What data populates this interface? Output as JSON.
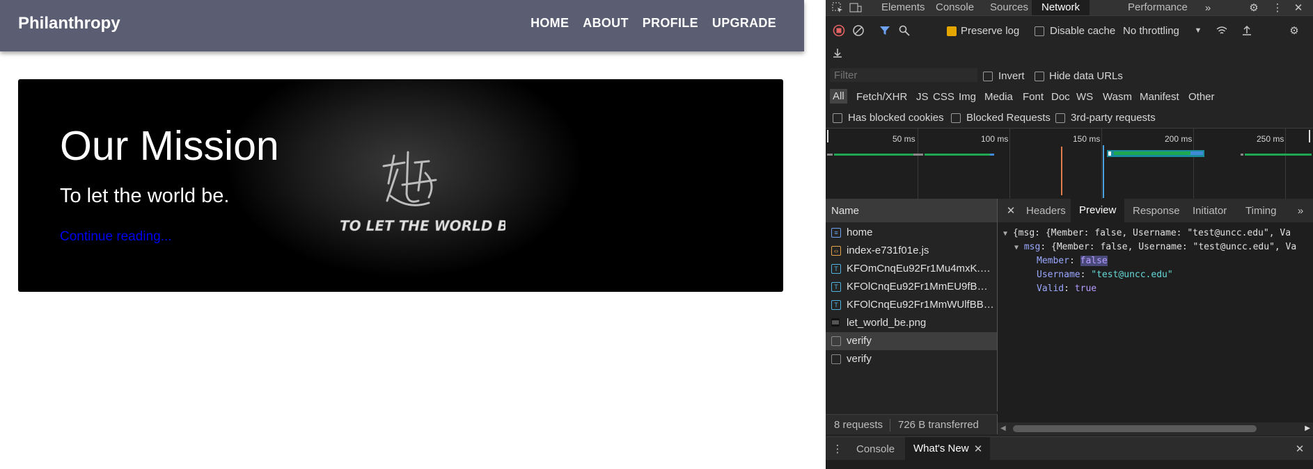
{
  "site": {
    "brand": "Philanthropy",
    "nav": [
      "HOME",
      "ABOUT",
      "PROFILE",
      "UPGRADE"
    ],
    "hero": {
      "title": "Our Mission",
      "subtitle": "To let the world be.",
      "link": "Continue reading...",
      "logo_text": "TO LET THE WORLD BE"
    }
  },
  "devtools": {
    "tabs": [
      "Elements",
      "Console",
      "Sources",
      "Network",
      "Performance"
    ],
    "active_tab": "Network",
    "toolbar": {
      "preserve_log": "Preserve log",
      "preserve_log_checked": true,
      "disable_cache": "Disable cache",
      "throttling": "No throttling"
    },
    "filter": {
      "placeholder": "Filter",
      "invert": "Invert",
      "hide_data_urls": "Hide data URLs"
    },
    "types": [
      "All",
      "Fetch/XHR",
      "JS",
      "CSS",
      "Img",
      "Media",
      "Font",
      "Doc",
      "WS",
      "Wasm",
      "Manifest",
      "Other"
    ],
    "blocked": {
      "has_blocked_cookies": "Has blocked cookies",
      "blocked_requests": "Blocked Requests",
      "third_party": "3rd-party requests"
    },
    "timeline_ticks": [
      "50 ms",
      "100 ms",
      "150 ms",
      "200 ms",
      "250 ms"
    ],
    "name_header": "Name",
    "requests": [
      {
        "name": "home",
        "icon": "document-icon"
      },
      {
        "name": "index-e731f01e.js",
        "icon": "script-icon"
      },
      {
        "name": "KFOmCnqEu92Fr1Mu4mxK.wo...",
        "icon": "font-icon"
      },
      {
        "name": "KFOlCnqEu92Fr1MmEU9fBBc4...",
        "icon": "font-icon"
      },
      {
        "name": "KFOlCnqEu92Fr1MmWUlfBBc4...",
        "icon": "font-icon"
      },
      {
        "name": "let_world_be.png",
        "icon": "image-icon"
      },
      {
        "name": "verify",
        "icon": "xhr-icon"
      },
      {
        "name": "verify",
        "icon": "xhr-icon"
      }
    ],
    "status": {
      "requests": "8 requests",
      "transferred": "726 B transferred"
    },
    "detail_tabs": [
      "Headers",
      "Preview",
      "Response",
      "Initiator",
      "Timing"
    ],
    "active_detail_tab": "Preview",
    "preview": {
      "line1": "{msg: {Member: false, Username: \"test@uncc.edu\", Va",
      "line2_key": "msg",
      "line2_rest": "{Member: false, Username: \"test@uncc.edu\", Va",
      "member_key": "Member",
      "member_val": "false",
      "username_key": "Username",
      "username_val": "\"test@uncc.edu\"",
      "valid_key": "Valid",
      "valid_val": "true"
    },
    "drawer_tabs": [
      "Console",
      "What's New"
    ],
    "active_drawer_tab": "What's New"
  }
}
